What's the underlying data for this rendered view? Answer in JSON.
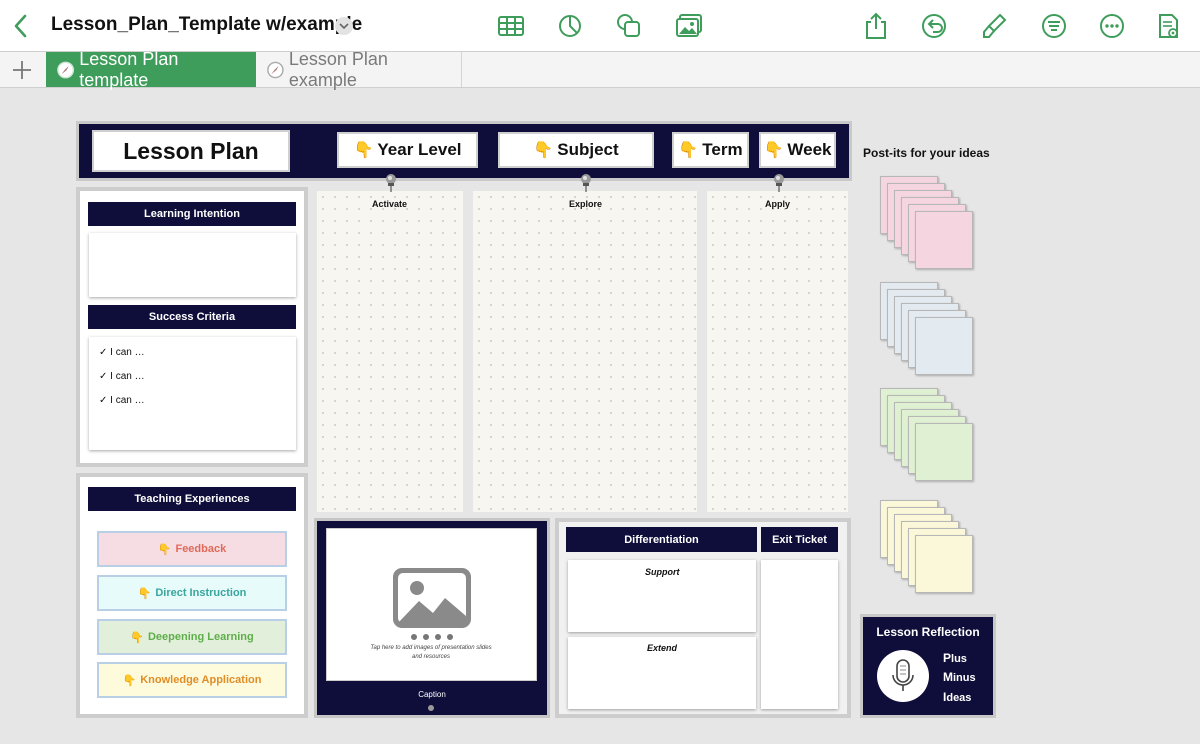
{
  "app": {
    "document_title": "Lesson_Plan_Template w/example",
    "icons": {
      "back": "chevron-left-icon",
      "title_menu": "chevron-down-icon",
      "table": "table-icon",
      "chart": "chart-icon",
      "shape": "shape-icon",
      "media": "media-icon",
      "share": "share-icon",
      "undo": "undo-icon",
      "format": "paintbrush-icon",
      "organize": "organize-icon",
      "more": "more-icon",
      "reader": "reading-view-icon"
    },
    "accent_color": "#3f9d5c"
  },
  "tabs": {
    "add": "+",
    "items": [
      {
        "label": "Lesson Plan template",
        "active": true
      },
      {
        "label": "Lesson Plan example",
        "active": false
      }
    ]
  },
  "sheet": {
    "header": {
      "title": "Lesson Plan",
      "finger": "👇",
      "year_level": "Year Level",
      "subject": "Subject",
      "term": "Term",
      "week": "Week",
      "band_color": "#0f0e3b"
    },
    "left_panel": {
      "learning_intention": "Learning Intention",
      "success_criteria": "Success Criteria",
      "criteria": [
        "✓ I can …",
        "✓ I can …",
        "✓  I can …"
      ]
    },
    "columns": {
      "activate": "Activate",
      "explore": "Explore",
      "apply": "Apply"
    },
    "teaching": {
      "title": "Teaching Experiences",
      "items": [
        {
          "label": "Feedback",
          "icon": "👇",
          "bg": "#f6dde3",
          "fg": "#e06a5a"
        },
        {
          "label": "Direct Instruction",
          "icon": "👇",
          "bg": "#e7fbfb",
          "fg": "#3aa59d"
        },
        {
          "label": "Deepening Learning",
          "icon": "👇",
          "bg": "#e2efda",
          "fg": "#5fae4c"
        },
        {
          "label": "Knowledge Application",
          "icon": "👇",
          "bg": "#fdfbdc",
          "fg": "#e08d28"
        }
      ]
    },
    "media": {
      "hint": "Tap here to add images of presentation slides and resources",
      "caption": "Caption"
    },
    "differentiation": {
      "title": "Differentiation",
      "exit_ticket": "Exit Ticket",
      "support": "Support",
      "extend": "Extend"
    },
    "postits": {
      "title": "Post-its for your ideas",
      "stacks": [
        {
          "color": "#f5d6e0"
        },
        {
          "color": "#e4ebf0"
        },
        {
          "color": "#dff0d3"
        },
        {
          "color": "#fbf8d9"
        }
      ]
    },
    "reflection": {
      "title": "Lesson Reflection",
      "lines": [
        {
          "cap": "P",
          "rest": "lus"
        },
        {
          "cap": "M",
          "rest": "inus"
        },
        {
          "cap": "I",
          "rest": "deas"
        }
      ]
    }
  }
}
